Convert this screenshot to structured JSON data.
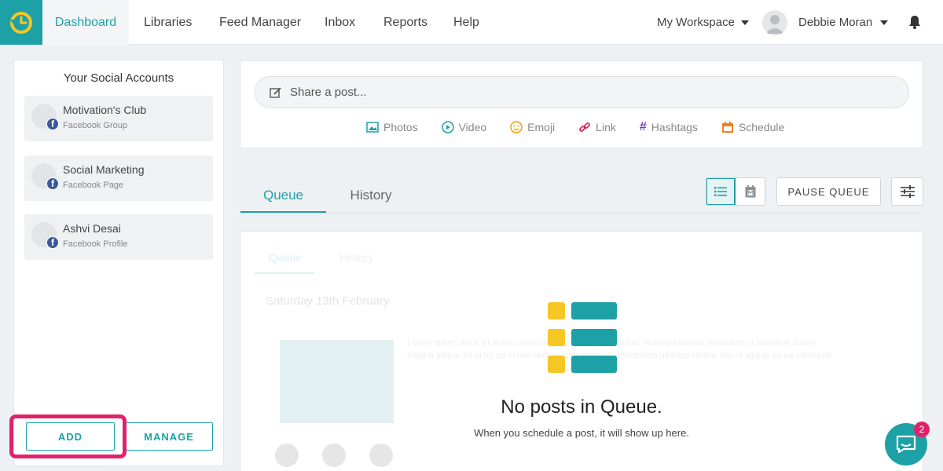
{
  "nav": {
    "items": [
      {
        "label": "Dashboard",
        "active": true
      },
      {
        "label": "Libraries"
      },
      {
        "label": "Feed Manager"
      },
      {
        "label": "Inbox"
      },
      {
        "label": "Reports"
      },
      {
        "label": "Help"
      }
    ],
    "workspace": "My Workspace",
    "user": "Debbie Moran"
  },
  "sidebar": {
    "title": "Your Social Accounts",
    "accounts": [
      {
        "name": "Motivation's Club",
        "type": "Facebook Group"
      },
      {
        "name": "Social Marketing",
        "type": "Facebook Page"
      },
      {
        "name": "Ashvi Desai",
        "type": "Facebook Profile"
      }
    ],
    "add_label": "ADD",
    "manage_label": "MANAGE"
  },
  "composer": {
    "placeholder": "Share a post...",
    "tools": [
      {
        "label": "Photos",
        "icon": "photo-icon"
      },
      {
        "label": "Video",
        "icon": "video-icon"
      },
      {
        "label": "Emoji",
        "icon": "emoji-icon"
      },
      {
        "label": "Link",
        "icon": "link-icon"
      },
      {
        "label": "Hashtags",
        "icon": "hashtag-icon"
      },
      {
        "label": "Schedule",
        "icon": "calendar-icon"
      }
    ]
  },
  "tabs": {
    "queue": "Queue",
    "history": "History",
    "pause_label": "PAUSE QUEUE"
  },
  "empty": {
    "title": "No posts in Queue.",
    "subtitle": "When you schedule a post, it will show up here.",
    "ghost_tab_queue": "Queue",
    "ghost_tab_history": "History",
    "ghost_date": "Saturday 13th February",
    "ghost_text_1": "Lorem ipsum dolor sit amet consectetur adipiscing elit sed do eiusmod tempor incididunt ut labore et dolore",
    "ghost_text_2": "magna aliqua. Ut enim ad minim veniam quis nostrud exercitation ullamco laboris nisi ut aliquip ex ea commodo"
  },
  "chat": {
    "badge": "2"
  },
  "colors": {
    "accent": "#1da1a6",
    "highlight": "#e0226b",
    "facebook": "#3b5998",
    "yellow": "#f6c624"
  }
}
